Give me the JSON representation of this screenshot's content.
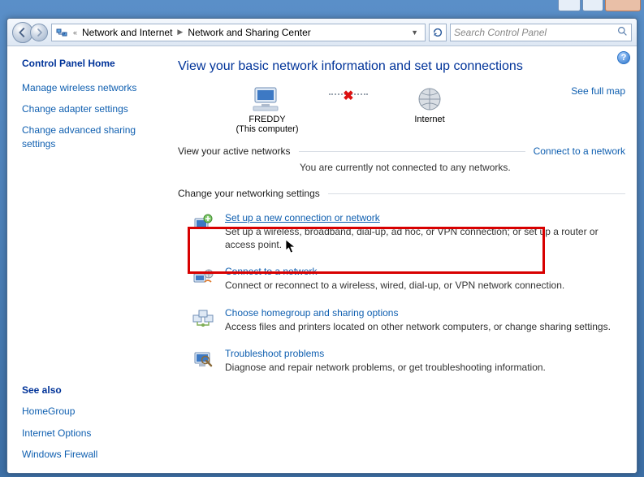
{
  "toolbar": {
    "breadcrumb": [
      "Network and Internet",
      "Network and Sharing Center"
    ],
    "search_placeholder": "Search Control Panel"
  },
  "sidebar": {
    "home": "Control Panel Home",
    "links": [
      "Manage wireless networks",
      "Change adapter settings",
      "Change advanced sharing settings"
    ],
    "see_also_label": "See also",
    "see_also": [
      "HomeGroup",
      "Internet Options",
      "Windows Firewall"
    ]
  },
  "main": {
    "title": "View your basic network information and set up connections",
    "see_full_map": "See full map",
    "nodes": {
      "computer_name": "FREDDY",
      "computer_sub": "(This computer)",
      "internet": "Internet"
    },
    "active_label": "View your active networks",
    "active_status": "You are currently not connected to any networks.",
    "connect_link": "Connect to a network",
    "change_label": "Change your networking settings",
    "settings": [
      {
        "title": "Set up a new connection or network",
        "desc": "Set up a wireless, broadband, dial-up, ad hoc, or VPN connection; or set up a router or access point."
      },
      {
        "title": "Connect to a network",
        "desc": "Connect or reconnect to a wireless, wired, dial-up, or VPN network connection."
      },
      {
        "title": "Choose homegroup and sharing options",
        "desc": "Access files and printers located on other network computers, or change sharing settings."
      },
      {
        "title": "Troubleshoot problems",
        "desc": "Diagnose and repair network problems, or get troubleshooting information."
      }
    ]
  }
}
